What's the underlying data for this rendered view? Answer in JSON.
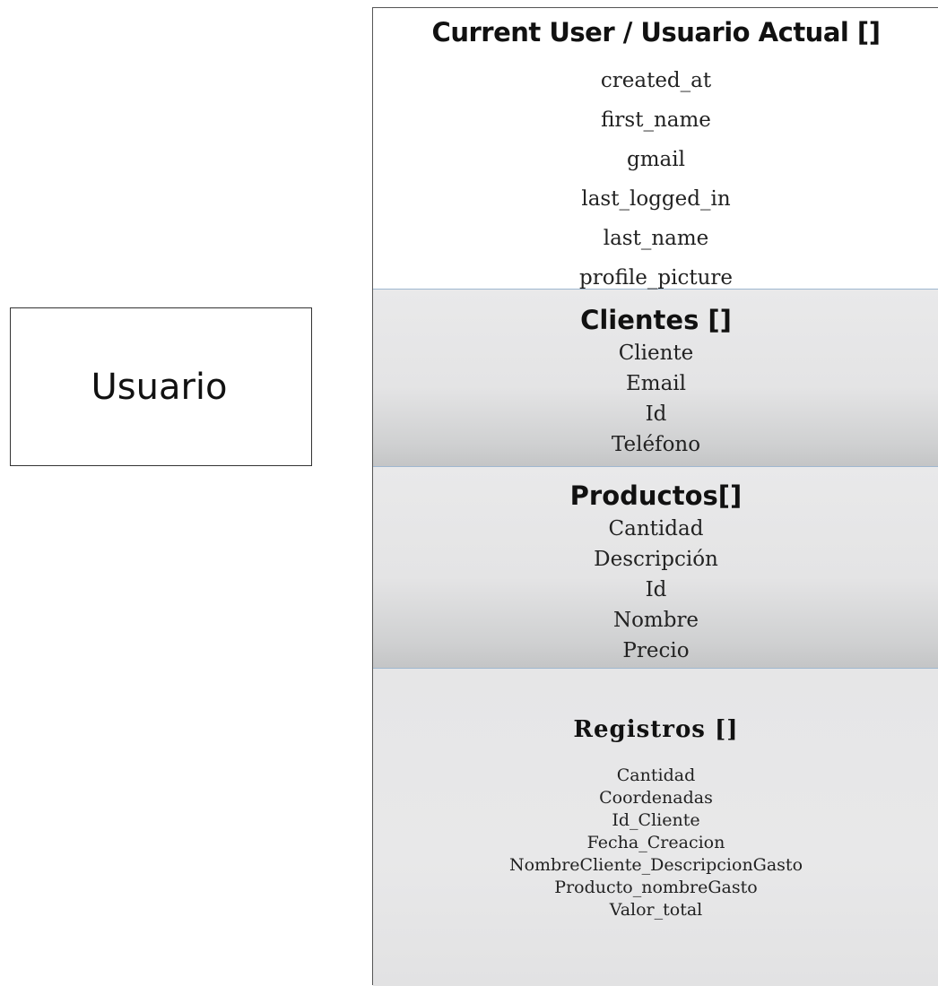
{
  "entity": {
    "label": "Usuario"
  },
  "sections": {
    "current_user": {
      "title": "Current User / Usuario Actual []",
      "fields": [
        "created_at",
        "first_name",
        "gmail",
        "last_logged_in",
        "last_name",
        "profile_picture"
      ]
    },
    "clientes": {
      "title": "Clientes []",
      "fields": [
        "Cliente",
        "Email",
        "Id",
        "Teléfono"
      ]
    },
    "productos": {
      "title": "Productos[]",
      "fields": [
        "Cantidad",
        "Descripción",
        "Id",
        "Nombre",
        "Precio"
      ]
    },
    "registros": {
      "title": "Registros []",
      "fields": [
        "Cantidad",
        "Coordenadas",
        "Id_Cliente",
        "Fecha_Creacion",
        "NombreCliente_DescripcionGasto",
        "Producto_nombreGasto",
        "Valor_total"
      ]
    }
  },
  "colors": {
    "border": "#333333",
    "section_divider": "#9fb7cf",
    "section_fill": "#e4e4e5"
  }
}
